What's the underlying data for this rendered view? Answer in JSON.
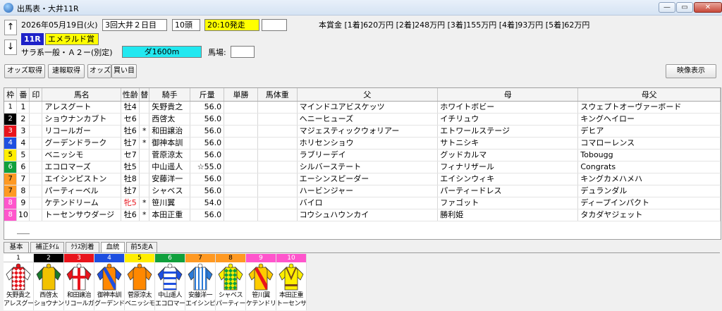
{
  "window": {
    "title": "出馬表・大井11R"
  },
  "header": {
    "date": "2026年05月19日(火)",
    "meeting": "3回大井２日目",
    "head_count": "10頭",
    "post_time": "20:10発走",
    "race_num": "11R",
    "race_name": "エメラルド賞",
    "race_class": "サラ系一般・Ａ２ー(別定)",
    "course": "ダ1600m",
    "track_label": "馬場:",
    "prize": "本賞金 [1着]620万円 [2着]248万円 [3着]155万円 [4着]93万円 [5着]62万円"
  },
  "toolbar": {
    "odds_fetch": "オッズ取得",
    "quick_fetch": "速報取得",
    "odds": "オッズ",
    "buy": "買い目",
    "video": "映像表示"
  },
  "table": {
    "columns": [
      "枠",
      "番",
      "印",
      "馬名",
      "性齢",
      "替",
      "騎手",
      "斤量",
      "単勝",
      "馬体重",
      "父",
      "母",
      "母父"
    ],
    "rows": [
      {
        "waku": "1",
        "num": "1",
        "mark": "",
        "horse": "アレスグート",
        "sexage": "牡4",
        "change": "",
        "jockey": "矢野貴之",
        "weight": "56.0",
        "odds": "",
        "body": "",
        "sire": "マインドユアビスケッツ",
        "dam": "ホワイトボビー",
        "bms": "スウェプトオーヴァーボード"
      },
      {
        "waku": "2",
        "num": "2",
        "mark": "",
        "horse": "ショウナンカブト",
        "sexage": "セ6",
        "change": "",
        "jockey": "西啓太",
        "weight": "56.0",
        "odds": "",
        "body": "",
        "sire": "ヘニーヒューズ",
        "dam": "イチリュウ",
        "bms": "キングヘイロー"
      },
      {
        "waku": "3",
        "num": "3",
        "mark": "",
        "horse": "リコールガー",
        "sexage": "牡6",
        "change": "*",
        "jockey": "和田譲治",
        "weight": "56.0",
        "odds": "",
        "body": "",
        "sire": "マジェスティックウォリアー",
        "dam": "エトワールステージ",
        "bms": "デヒア"
      },
      {
        "waku": "4",
        "num": "4",
        "mark": "",
        "horse": "グーデンドラーク",
        "sexage": "牡7",
        "change": "*",
        "jockey": "御神本訓",
        "weight": "56.0",
        "odds": "",
        "body": "",
        "sire": "ホリセンショウ",
        "dam": "サトニシキ",
        "bms": "コマローレンス"
      },
      {
        "waku": "5",
        "num": "5",
        "mark": "",
        "horse": "ベニッシモ",
        "sexage": "セ7",
        "change": "",
        "jockey": "菅原涼太",
        "weight": "56.0",
        "odds": "",
        "body": "",
        "sire": "ラブリーデイ",
        "dam": "グッドカルマ",
        "bms": "Tobougg"
      },
      {
        "waku": "6",
        "num": "6",
        "mark": "",
        "horse": "エコロマーズ",
        "sexage": "牡5",
        "change": "",
        "jockey": "中山遥人",
        "weight": "☆55.0",
        "odds": "",
        "body": "",
        "sire": "シルバーステート",
        "dam": "フィナリザール",
        "bms": "Congrats"
      },
      {
        "waku": "7",
        "num": "7",
        "mark": "",
        "horse": "エイシンピストン",
        "sexage": "牡8",
        "change": "",
        "jockey": "安藤洋一",
        "weight": "56.0",
        "odds": "",
        "body": "",
        "sire": "エーシンスピーダー",
        "dam": "エイシンウィキ",
        "bms": "キングカメハメハ"
      },
      {
        "waku": "7",
        "num": "8",
        "mark": "",
        "horse": "パーティーベル",
        "sexage": "牡7",
        "change": "",
        "jockey": "シャベス",
        "weight": "56.0",
        "odds": "",
        "body": "",
        "sire": "ハービンジャー",
        "dam": "パーティードレス",
        "bms": "デュランダル"
      },
      {
        "waku": "8",
        "num": "9",
        "mark": "",
        "horse": "ケテンドリーム",
        "sexage": "牝5",
        "change": "*",
        "jockey": "笹川翼",
        "weight": "54.0",
        "odds": "",
        "body": "",
        "sire": "バイロ",
        "dam": "ファゴット",
        "bms": "ディープインパクト"
      },
      {
        "waku": "8",
        "num": "10",
        "mark": "",
        "horse": "トーセンサウダージ",
        "sexage": "牡6",
        "change": "*",
        "jockey": "本田正重",
        "weight": "56.0",
        "odds": "",
        "body": "",
        "sire": "コウシュハウンカイ",
        "dam": "勝利姫",
        "bms": "タカダヤジェット"
      }
    ]
  },
  "waku_colors": {
    "1": {
      "bg": "#ffffff",
      "fg": "#000000"
    },
    "2": {
      "bg": "#000000",
      "fg": "#ffffff"
    },
    "3": {
      "bg": "#e8141c",
      "fg": "#ffffff"
    },
    "4": {
      "bg": "#1e4fe0",
      "fg": "#ffffff"
    },
    "5": {
      "bg": "#ffee00",
      "fg": "#000000"
    },
    "6": {
      "bg": "#10a03c",
      "fg": "#ffffff"
    },
    "7": {
      "bg": "#ff9922",
      "fg": "#000000"
    },
    "8": {
      "bg": "#ff55cc",
      "fg": "#ffffff"
    }
  },
  "tabs": [
    "基本",
    "補正ﾀｲﾑ",
    "ｸﾗｽ別着",
    "血統",
    "前5走A"
  ],
  "active_tab": 3,
  "silks": [
    {
      "num": "1",
      "jockey": "矢野貴之",
      "horse": "アレスグート",
      "body": "#e8141c",
      "pattern": "diamonds",
      "sleeve": "#ffffff"
    },
    {
      "num": "2",
      "jockey": "西啓太",
      "horse": "ショウナンカブト",
      "body": "#f2c200",
      "pattern": "plain",
      "sleeve": "#1a7a2a"
    },
    {
      "num": "3",
      "jockey": "和田譲治",
      "horse": "リコールガー",
      "body": "#ffffff",
      "pattern": "cross",
      "sleeve": "#e8141c"
    },
    {
      "num": "4",
      "jockey": "御神本訓",
      "horse": "グーデンドラーク",
      "body": "#ff8800",
      "pattern": "sash",
      "sleeve": "#1e4fe0"
    },
    {
      "num": "5",
      "jockey": "菅原涼太",
      "horse": "ベニッシモ",
      "body": "#ff8800",
      "pattern": "plain",
      "sleeve": "#ff8800"
    },
    {
      "num": "6",
      "jockey": "中山遥人",
      "horse": "エコロマーズ",
      "body": "#ffffff",
      "pattern": "hoops",
      "sleeve": "#1e4fe0"
    },
    {
      "num": "7",
      "jockey": "安藤洋一",
      "horse": "エイシンピストン",
      "body": "#ffffff",
      "pattern": "stripes",
      "sleeve": "#2a7ad8"
    },
    {
      "num": "8",
      "jockey": "シャベス",
      "horse": "パーティーベル",
      "body": "#ffee00",
      "pattern": "diamonds-green",
      "sleeve": "#ffee00"
    },
    {
      "num": "9",
      "jockey": "笹川翼",
      "horse": "ケテンドリーム",
      "body": "#ffcc00",
      "pattern": "sash-red",
      "sleeve": "#ffcc00"
    },
    {
      "num": "10",
      "jockey": "本田正重",
      "horse": "トーセンサウダージ",
      "body": "#ffee00",
      "pattern": "seams",
      "sleeve": "#ffee00"
    }
  ]
}
